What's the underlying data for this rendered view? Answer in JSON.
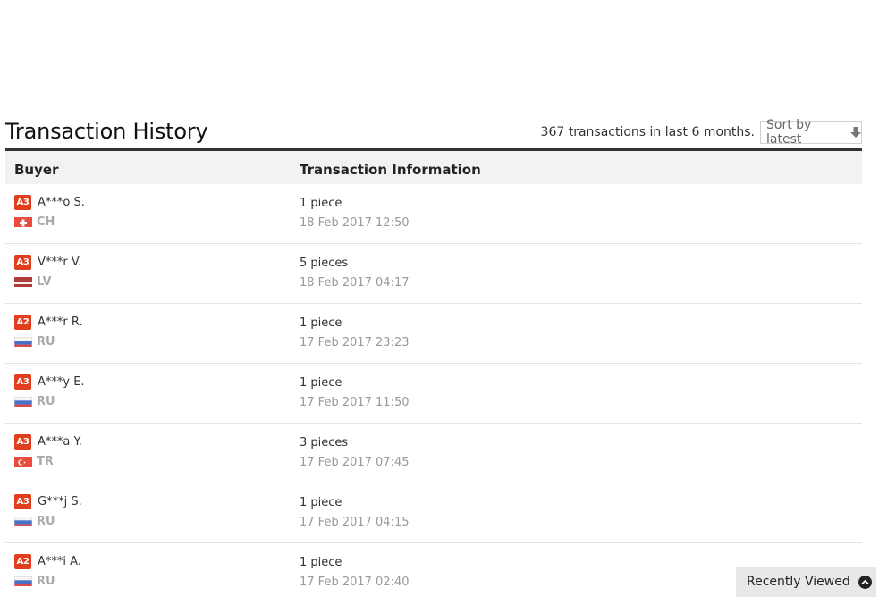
{
  "section": {
    "title": "Transaction History",
    "summary": "367 transactions in last 6 months.",
    "sort_label": "Sort by latest"
  },
  "table": {
    "headers": {
      "buyer": "Buyer",
      "info": "Transaction Information"
    },
    "rows": [
      {
        "badge": "A3",
        "buyer": "A***o S.",
        "country": "CH",
        "flag": "switzerland-flag",
        "quantity": "1 piece",
        "date": "18 Feb 2017 12:50"
      },
      {
        "badge": "A3",
        "buyer": "V***r V.",
        "country": "LV",
        "flag": "latvia-flag",
        "quantity": "5 pieces",
        "date": "18 Feb 2017 04:17"
      },
      {
        "badge": "A2",
        "buyer": "A***r R.",
        "country": "RU",
        "flag": "russia-flag",
        "quantity": "1 piece",
        "date": "17 Feb 2017 23:23"
      },
      {
        "badge": "A3",
        "buyer": "A***y E.",
        "country": "RU",
        "flag": "russia-flag",
        "quantity": "1 piece",
        "date": "17 Feb 2017 11:50"
      },
      {
        "badge": "A3",
        "buyer": "A***a Y.",
        "country": "TR",
        "flag": "turkey-flag",
        "quantity": "3 pieces",
        "date": "17 Feb 2017 07:45"
      },
      {
        "badge": "A3",
        "buyer": "G***j S.",
        "country": "RU",
        "flag": "russia-flag",
        "quantity": "1 piece",
        "date": "17 Feb 2017 04:15"
      },
      {
        "badge": "A2",
        "buyer": "A***i A.",
        "country": "RU",
        "flag": "russia-flag",
        "quantity": "1 piece",
        "date": "17 Feb 2017 02:40"
      }
    ]
  },
  "recently_viewed": {
    "label": "Recently Viewed",
    "icon": "chevron-up-circle-icon"
  },
  "colors": {
    "badge": "#e03e1c",
    "header_border": "#333333",
    "header_bg": "#f2f2f2",
    "country_text": "#aaaaaa",
    "date_text": "#999999"
  }
}
